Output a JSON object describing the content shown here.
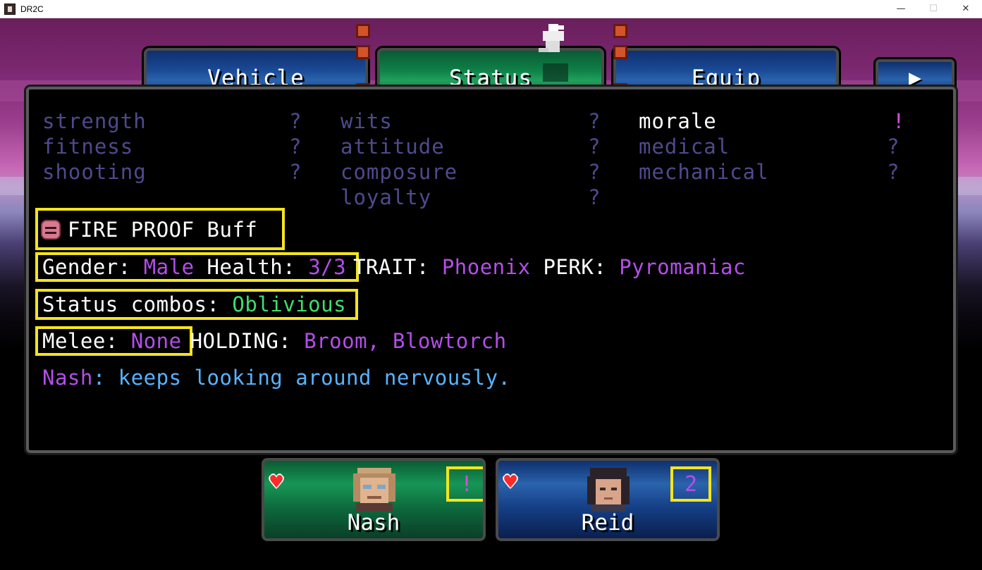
{
  "window": {
    "title": "DR2C",
    "minimize": "—",
    "maximize": "☐",
    "close": "✕"
  },
  "tabs": {
    "vehicle": "Vehicle",
    "status": "Status",
    "equip": "Equip",
    "next_arrow": "▶"
  },
  "stats": {
    "col1": [
      {
        "name": "strength",
        "value": "?"
      },
      {
        "name": "fitness",
        "value": "?"
      },
      {
        "name": "shooting",
        "value": "?"
      }
    ],
    "col2": [
      {
        "name": "wits",
        "value": "?"
      },
      {
        "name": "attitude",
        "value": "?"
      },
      {
        "name": "composure",
        "value": "?"
      },
      {
        "name": "loyalty",
        "value": "?"
      }
    ],
    "col3": [
      {
        "name": "morale",
        "value": "!"
      },
      {
        "name": "medical",
        "value": "?"
      },
      {
        "name": "mechanical",
        "value": "?"
      }
    ]
  },
  "buff": {
    "icon": "fire-proof-icon",
    "text": "FIRE PROOF Buff"
  },
  "info": {
    "gender_label": "Gender:",
    "gender_value": "Male",
    "health_label": "Health:",
    "health_value": "3/3",
    "trait_label": "TRAIT:",
    "trait_value": "Phoenix",
    "perk_label": "PERK:",
    "perk_value": "Pyromaniac",
    "combos_label": "Status combos:",
    "combos_value": "Oblivious",
    "melee_label": "Melee:",
    "melee_value": "None",
    "holding_label": "HOLDING:",
    "holding_value": "Broom, Blowtorch",
    "flavor_name": "Nash",
    "flavor_text": ": keeps looking around nervously."
  },
  "party": [
    {
      "name": "Nash",
      "number": "!",
      "heart_icon": "heart-icon",
      "number_color": "#d34fd8"
    },
    {
      "name": "Reid",
      "number": "2",
      "heart_icon": "heart-icon",
      "number_color": "#b44ee8"
    }
  ],
  "colors": {
    "purple": "#b44ee8",
    "green": "#3fe06a",
    "blue": "#57b3ff",
    "highlight": "#f5e51c",
    "dim_stat": "#4e4a8c"
  }
}
